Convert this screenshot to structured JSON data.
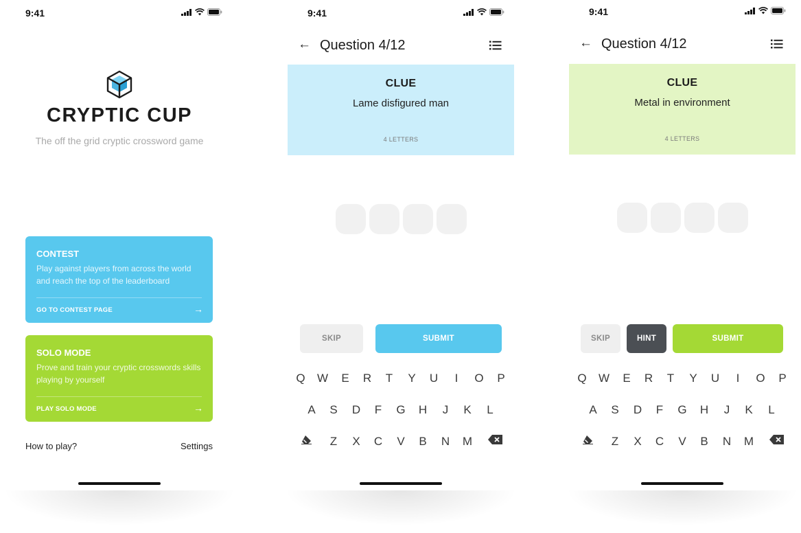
{
  "colors": {
    "contest_blue": "#58c8ee",
    "solo_green": "#a4d935",
    "clue_blue_bg": "#cbeefb",
    "clue_green_bg": "#e3f5c4",
    "hint_dark": "#4b4f54",
    "tile_grey": "#f1f1f1"
  },
  "status_bar": {
    "time": "9:41",
    "icons": [
      "signal-icon",
      "wifi-icon",
      "battery-icon"
    ]
  },
  "home": {
    "title": "CRYPTIC CUP",
    "subtitle": "The off the grid cryptic crossword game",
    "logo_icon": "cube-logo-icon",
    "contest": {
      "title": "CONTEST",
      "description": "Play against players from across the world and reach the top of the leaderboard",
      "link": "GO TO CONTEST PAGE",
      "arrow": "→"
    },
    "solo": {
      "title": "SOLO MODE",
      "description": "Prove and train your cryptic crosswords skills playing by yourself",
      "link": "PLAY SOLO MODE",
      "arrow": "→"
    },
    "how_to_play": "How to play?",
    "settings": "Settings"
  },
  "game_contest": {
    "back": "←",
    "title": "Question 4/12",
    "clue_label": "CLUE",
    "clue": "Lame disfigured man",
    "letters": "4 LETTERS",
    "letter_count": 4,
    "skip": "SKIP",
    "submit": "SUBMIT"
  },
  "game_solo": {
    "back": "←",
    "title": "Question 4/12",
    "clue_label": "CLUE",
    "clue": "Metal in environment",
    "letters": "4 LETTERS",
    "letter_count": 4,
    "skip": "SKIP",
    "hint": "HINT",
    "submit": "SUBMIT"
  },
  "keyboard": {
    "row1": [
      "Q",
      "W",
      "E",
      "R",
      "T",
      "Y",
      "U",
      "I",
      "O",
      "P"
    ],
    "row2": [
      "A",
      "S",
      "D",
      "F",
      "G",
      "H",
      "J",
      "K",
      "L"
    ],
    "row3": [
      "Z",
      "X",
      "C",
      "V",
      "B",
      "N",
      "M"
    ],
    "clear_icon": "eraser-icon",
    "backspace_icon": "backspace-icon"
  }
}
